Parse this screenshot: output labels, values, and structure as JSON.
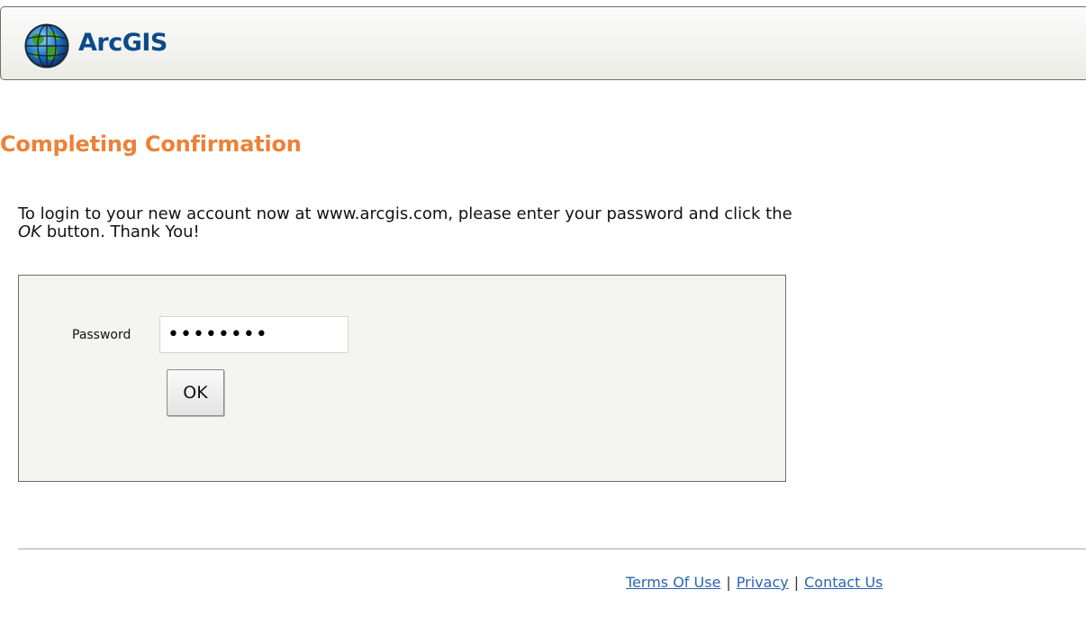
{
  "header": {
    "logo_text": "ArcGIS",
    "logo_icon": "globe-icon"
  },
  "page_title": "Completing Confirmation",
  "instructions": {
    "part1": "To login to your new account now at www.arcgis.com, please enter your password and click the ",
    "emphasis": "OK",
    "part2": " button. Thank You!"
  },
  "form": {
    "password_label": "Password",
    "password_value": "••••••••",
    "ok_label": "OK"
  },
  "footer": {
    "links": [
      "Terms Of Use",
      "Privacy",
      "Contact Us"
    ],
    "separator": "|"
  },
  "colors": {
    "title": "#eb8237",
    "logo_text": "#0b4a8b",
    "link": "#2a64b4",
    "box_background": "#f4f4f1"
  }
}
